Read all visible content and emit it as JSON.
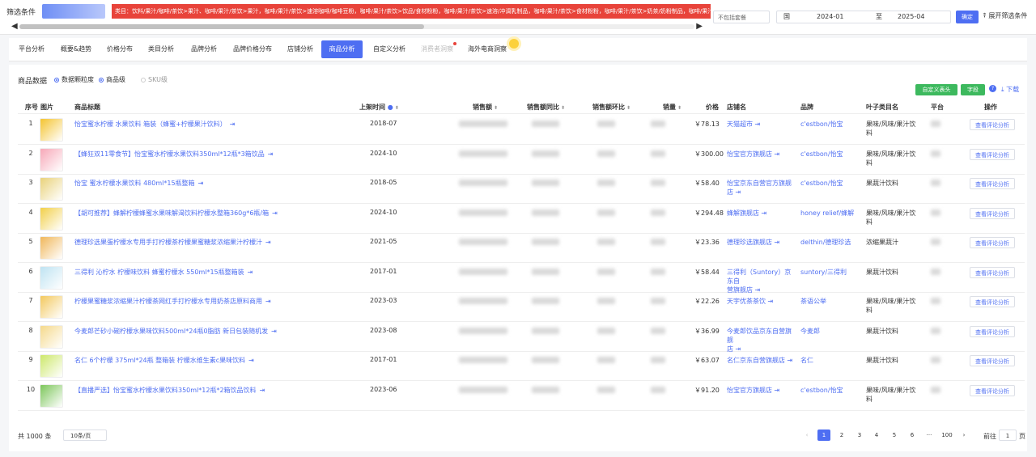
{
  "filter": {
    "label": "筛选条件",
    "red_bar_text": "类目：饮料/果汁/咖啡/茶饮>果汁、咖啡/果汁/茶饮>果汁，咖啡/果汁/茶饮>速溶咖啡/咖啡豆粉，咖啡/果汁/茶饮>饮品/食材粉粉，咖啡/果汁/茶饮>速溶/冲调乳制品，咖啡/果汁/茶饮>食材粉粉，咖啡/果汁/茶饮>奶茶/奶粉制品，咖啡/果汁/茶饮>奶制品",
    "select_value": "不包括套餐",
    "date_from_label": "国",
    "date_from": "2024-01",
    "date_sep": "至",
    "date_to": "2025-04",
    "confirm_label": "确定",
    "expand_label": "展开筛选条件"
  },
  "tabs": [
    {
      "label": "平台分析"
    },
    {
      "label": "概要&趋势"
    },
    {
      "label": "价格分布"
    },
    {
      "label": "类目分析"
    },
    {
      "label": "品牌分析"
    },
    {
      "label": "品牌价格分布"
    },
    {
      "label": "店铺分析"
    },
    {
      "label": "商品分析"
    },
    {
      "label": "自定义分析"
    },
    {
      "label": "消费者洞察"
    },
    {
      "label": "海外电商洞察"
    }
  ],
  "data_section": {
    "title": "商品数据",
    "radios": [
      "数据颗粒度",
      "商品级",
      "SKU级"
    ],
    "btn_custom": "自定义表头",
    "btn_field": "字段",
    "download": "下载"
  },
  "columns": [
    "序号",
    "图片",
    "商品标题",
    "上架时间",
    "销售额",
    "销售额同比",
    "销售额环比",
    "销量",
    "价格",
    "店铺名",
    "品牌",
    "叶子类目名",
    "平台",
    "操作"
  ],
  "rows": [
    {
      "idx": "1",
      "title": "怡宝蜜水柠檬 水果饮料 箱装（蜂蜜+柠檬果汁饮料）",
      "date": "2018-07",
      "price": "￥78.13",
      "store": "天猫超市",
      "brand": "c'estbon/怡宝",
      "cat1": "果味/风味/果汁饮",
      "cat2": "料",
      "op": "查看评论分析",
      "img": "#f4c430"
    },
    {
      "idx": "2",
      "title": "【蜂狂双11零食节】怡宝蜜水柠檬水果饮料350ml*12瓶*3箱饮品",
      "date": "2024-10",
      "price": "￥300.00",
      "store": "怡宝官方旗舰店",
      "brand": "c'estbon/怡宝",
      "cat1": "果味/风味/果汁饮",
      "cat2": "料",
      "op": "查看评论分析",
      "img": "#f7a8b8"
    },
    {
      "idx": "3",
      "title": "怡宝 蜜水柠檬水果饮料 480ml*15瓶整箱",
      "date": "2018-05",
      "price": "￥58.40",
      "store": "怡宝京东自营官方旗舰店",
      "brand": "c'estbon/怡宝",
      "cat1": "果蔬汁饮料",
      "cat2": "",
      "op": "查看评论分析",
      "img": "#e9d27a"
    },
    {
      "idx": "4",
      "title": "【胡可推荐】蜂解柠檬蜂蜜水果味解渴饮料柠檬水整箱360g*6瓶/箱",
      "date": "2024-10",
      "price": "￥294.48",
      "store": "蜂解旗舰店",
      "brand": "honey relief/蜂解",
      "cat1": "果味/风味/果汁饮",
      "cat2": "料",
      "op": "查看评论分析",
      "img": "#f2d04a"
    },
    {
      "idx": "5",
      "title": "德理珍选果蛋柠檬水专用手打柠檬茶柠檬果蜜糖浆浓缩果汁柠檬汁",
      "date": "2021-05",
      "price": "￥23.36",
      "store": "德理珍选旗舰店",
      "brand": "delthin/德理珍选",
      "cat1": "浓缩果蔬汁",
      "cat2": "",
      "op": "查看评论分析",
      "img": "#f0b75a"
    },
    {
      "idx": "6",
      "title": "三得利 沁柠水 柠檬味饮料 蜂蜜柠檬水 550ml*15瓶整箱装",
      "date": "2017-01",
      "price": "￥58.44",
      "store": "三得利（Suntory）京东自",
      "store2": "营旗舰店",
      "brand": "suntory/三得利",
      "cat1": "果蔬汁饮料",
      "cat2": "",
      "op": "查看评论分析",
      "img": "#bfe3f2"
    },
    {
      "idx": "7",
      "title": "柠檬果蜜糖浆浓缩果汁柠檬茶网红手打柠檬水专用奶茶店原料商用",
      "date": "2023-03",
      "price": "￥22.26",
      "store": "天宇优茶茶饮",
      "brand": "茶语公举",
      "cat1": "果味/风味/果汁饮",
      "cat2": "料",
      "op": "查看评论分析",
      "img": "#f3c95e"
    },
    {
      "idx": "8",
      "title": "今麦郎芒砂小碗柠檬水果味饮料500ml*24瓶0脂肪 新日包装随机发",
      "date": "2023-08",
      "price": "￥36.99",
      "store": "今麦郎饮品京东自营旗舰",
      "store2": "店",
      "brand": "今麦郎",
      "cat1": "果蔬汁饮料",
      "cat2": "",
      "op": "查看评论分析",
      "img": "#f5d98b"
    },
    {
      "idx": "9",
      "title": "名仁 6个柠檬 375ml*24瓶 整箱装 柠檬水维生素c果味饮料",
      "date": "2017-01",
      "price": "￥63.07",
      "store": "名仁京东自营旗舰店",
      "brand": "名仁",
      "cat1": "果蔬汁饮料",
      "cat2": "",
      "op": "查看评论分析",
      "img": "#cde86b"
    },
    {
      "idx": "10",
      "title": "【直播严选】怡宝蜜水柠檬水果饮料350ml*12瓶*2箱饮品饮料",
      "date": "2023-06",
      "price": "￥91.20",
      "store": "怡宝官方旗舰店",
      "brand": "c'estbon/怡宝",
      "cat1": "果味/风味/果汁饮",
      "cat2": "料",
      "op": "查看评论分析",
      "img": "#7cc65a"
    }
  ],
  "pagination": {
    "total": "共 1000 条",
    "page_size": "10条/页",
    "prev": "‹",
    "pages": [
      "1",
      "2",
      "3",
      "4",
      "5",
      "6",
      "···",
      "100"
    ],
    "next": "›",
    "goto_label": "前往",
    "goto_value": "1",
    "goto_suffix": "页"
  }
}
